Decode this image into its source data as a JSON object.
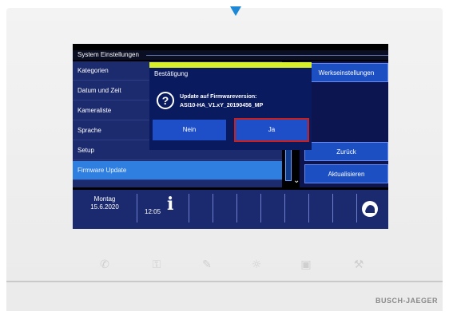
{
  "screen": {
    "title": "System Einstellungen",
    "menu": [
      {
        "label": "Kategorien"
      },
      {
        "label": "Datum und Zeit"
      },
      {
        "label": "Kameraliste"
      },
      {
        "label": "Sprache"
      },
      {
        "label": "Setup"
      },
      {
        "label": "Firmware Update"
      }
    ],
    "right_buttons": [
      {
        "label": "Werkseinstellungen"
      },
      {
        "label": "Zurück"
      },
      {
        "label": "Aktualisieren"
      }
    ],
    "status": {
      "day": "Montag",
      "date": "15.6.2020",
      "time": "12:05"
    }
  },
  "dialog": {
    "title": "Bestätigung",
    "message_line1": "Update auf Firmwareversion:",
    "message_line2": "ASI10-HA_V1.xY_20190456_MP",
    "no_label": "Nein",
    "yes_label": "Ja"
  },
  "device": {
    "brand": "BUSCH-JAEGER"
  },
  "colors": {
    "accent": "#1e4fc8",
    "highlight": "#c81f1f",
    "header": "#d8ef2b"
  },
  "icons": {
    "phone": "phone-icon",
    "key": "key-icon",
    "mute": "mute-icon",
    "light": "light-icon",
    "camera": "camera-icon",
    "wrench": "wrench-icon"
  }
}
